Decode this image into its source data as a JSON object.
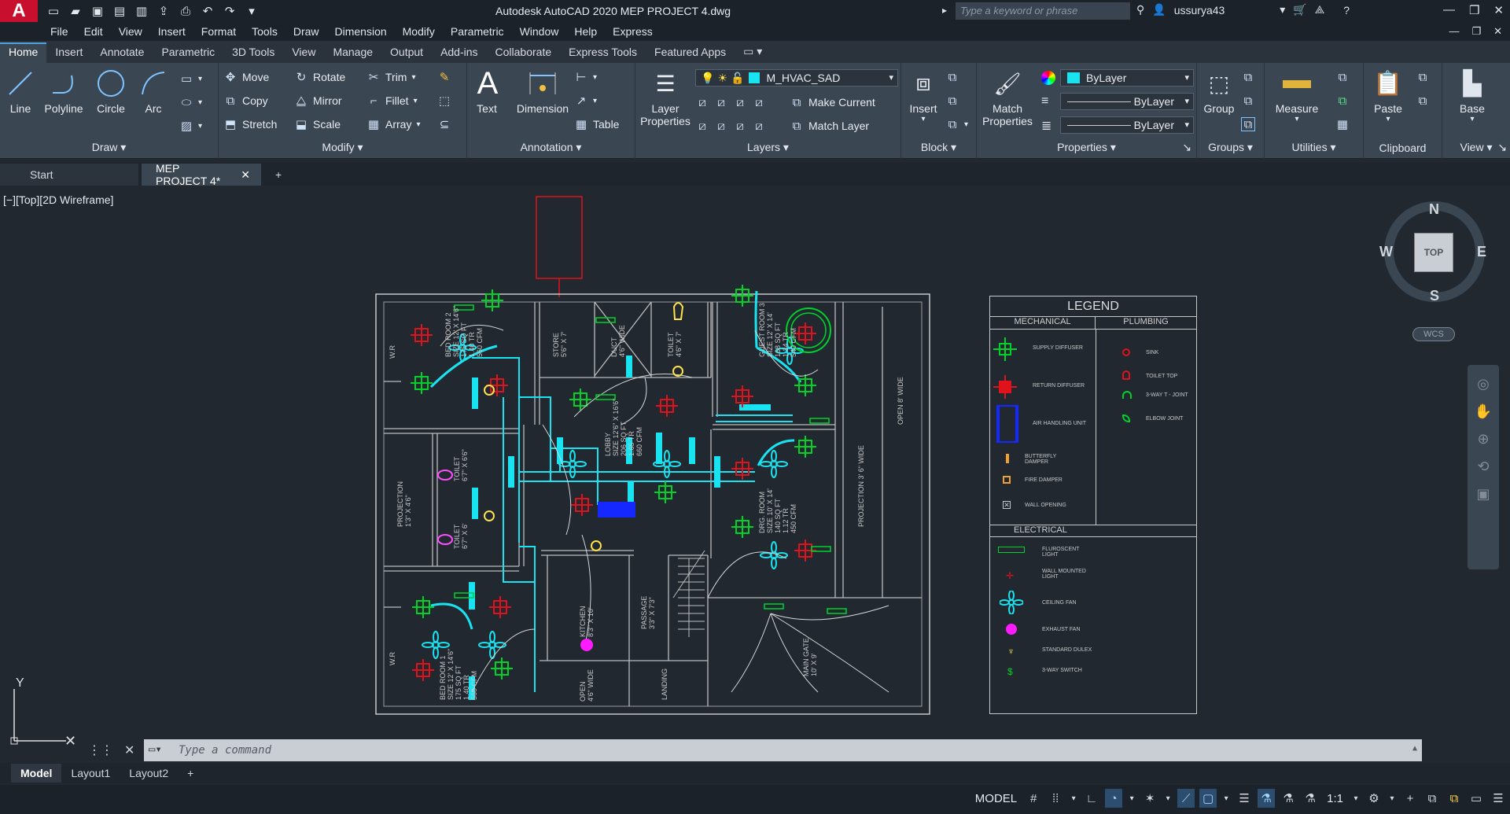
{
  "window": {
    "title": "Autodesk AutoCAD 2020    MEP PROJECT 4.dwg",
    "search_placeholder": "Type a keyword or phrase",
    "user": "ussurya43",
    "logo": "A"
  },
  "menu": [
    "File",
    "Edit",
    "View",
    "Insert",
    "Format",
    "Tools",
    "Draw",
    "Dimension",
    "Modify",
    "Parametric",
    "Window",
    "Help",
    "Express"
  ],
  "ribbon_tabs": [
    "Home",
    "Insert",
    "Annotate",
    "Parametric",
    "3D Tools",
    "View",
    "Manage",
    "Output",
    "Add-ins",
    "Collaborate",
    "Express Tools",
    "Featured Apps"
  ],
  "ribbon": {
    "draw": {
      "title": "Draw",
      "line": "Line",
      "polyline": "Polyline",
      "circle": "Circle",
      "arc": "Arc"
    },
    "modify": {
      "title": "Modify",
      "move": "Move",
      "rotate": "Rotate",
      "trim": "Trim",
      "copy": "Copy",
      "mirror": "Mirror",
      "fillet": "Fillet",
      "stretch": "Stretch",
      "scale": "Scale",
      "array": "Array"
    },
    "annotation": {
      "title": "Annotation",
      "text": "Text",
      "dimension": "Dimension",
      "table": "Table"
    },
    "layers": {
      "title": "Layers",
      "layer_properties_1": "Layer",
      "layer_properties_2": "Properties",
      "current_layer": "M_HVAC_SAD",
      "make_current": "Make Current",
      "match_layer": "Match Layer"
    },
    "block": {
      "title": "Block",
      "insert": "Insert"
    },
    "properties": {
      "title": "Properties",
      "match_1": "Match",
      "match_2": "Properties",
      "color": "ByLayer",
      "linetype": "ByLayer",
      "lineweight": "ByLayer"
    },
    "groups": {
      "title": "Groups",
      "group": "Group"
    },
    "utilities": {
      "title": "Utilities",
      "measure": "Measure"
    },
    "clipboard": {
      "title": "Clipboard",
      "paste": "Paste"
    },
    "view": {
      "title": "View",
      "base": "Base"
    }
  },
  "doc_tabs": {
    "start": "Start",
    "active": "MEP PROJECT 4*",
    "new": "+"
  },
  "viewport_label": "[−][Top][2D Wireframe]",
  "viewcube": {
    "n": "N",
    "s": "S",
    "e": "E",
    "w": "W",
    "top": "TOP",
    "wcs": "WCS"
  },
  "ucs": {
    "y": "Y"
  },
  "drawing": {
    "rooms": [
      {
        "label": "BED ROOM 2\nSIZE 12' X 14'6\"\n175 SQ FT\n1.40 TR\n560 CFM"
      },
      {
        "label": "STORE\n5'6\" X 7'"
      },
      {
        "label": "DUCT\n4'6\" WIDE"
      },
      {
        "label": "TOILET\n4'6\" X 7'"
      },
      {
        "label": "GUEST ROOM 3\nSIZE 12' X 14'\n168 SQ FT\n1.34 TR\n540 CFM"
      },
      {
        "label": "LOBBY\nSIZE 12'6\" X 16'6\"\n206 SQ FT\n1.65 TR\n660 CFM"
      },
      {
        "label": "TOILET\n6'7\" X 6'6\""
      },
      {
        "label": "TOILET\n6'7\" X 6'"
      },
      {
        "label": "PROJECTION\n1'3\" X 4'6\""
      },
      {
        "label": "DRG. ROOM\nSIZE 10' X 14'\n140 SQ FT\n1.12 TR\n450 CFM"
      },
      {
        "label": "PROJECTION 3' 6\" WIDE"
      },
      {
        "label": "OPEN 8' WIDE"
      },
      {
        "label": "KITCHEN\n8'3\" X 10'"
      },
      {
        "label": "PASSAGE\n3'3\" X 7'3\""
      },
      {
        "label": "BED ROOM 1\nSIZE 12' X 14'6\"\n175 SQ FT\n1.40 TR\n560 CFM"
      },
      {
        "label": "OPEN\n4'6\" WIDE"
      },
      {
        "label": "LANDING"
      },
      {
        "label": "MAIN GATE\n10' X 9'"
      },
      {
        "label": "W.R"
      },
      {
        "label": "W.R"
      }
    ]
  },
  "legend": {
    "title": "LEGEND",
    "mechanical_header": "MECHANICAL",
    "plumbing_header": "PLUMBING",
    "electrical_header": "ELECTRICAL",
    "mechanical": [
      "SUPPLY DIFFUSER",
      "RETURN DIFFUSER",
      "AIR HANDLING UNIT",
      "BUTTERFLY DAMPER",
      "FIRE DAMPER",
      "WALL OPENING"
    ],
    "plumbing": [
      "SINK",
      "TOILET TOP",
      "3-WAY T - JOINT",
      "ELBOW JOINT"
    ],
    "electrical": [
      "FLUROSCENT LIGHT",
      "WALL MOUNTED LIGHT",
      "CEILING FAN",
      "EXHAUST FAN",
      "STANDARD DULEX",
      "3-WAY SWITCH"
    ]
  },
  "command": {
    "placeholder": "Type a command"
  },
  "layout_tabs": [
    "Model",
    "Layout1",
    "Layout2",
    "+"
  ],
  "status": {
    "model": "MODEL",
    "scale": "1:1"
  },
  "colors": {
    "accent": "#4fa3e0",
    "hvac_supply": "#00d22a",
    "hvac_return": "#e0121c",
    "duct": "#19e3f0",
    "ahu": "#1428ff",
    "walls": "#c8c8c8"
  }
}
